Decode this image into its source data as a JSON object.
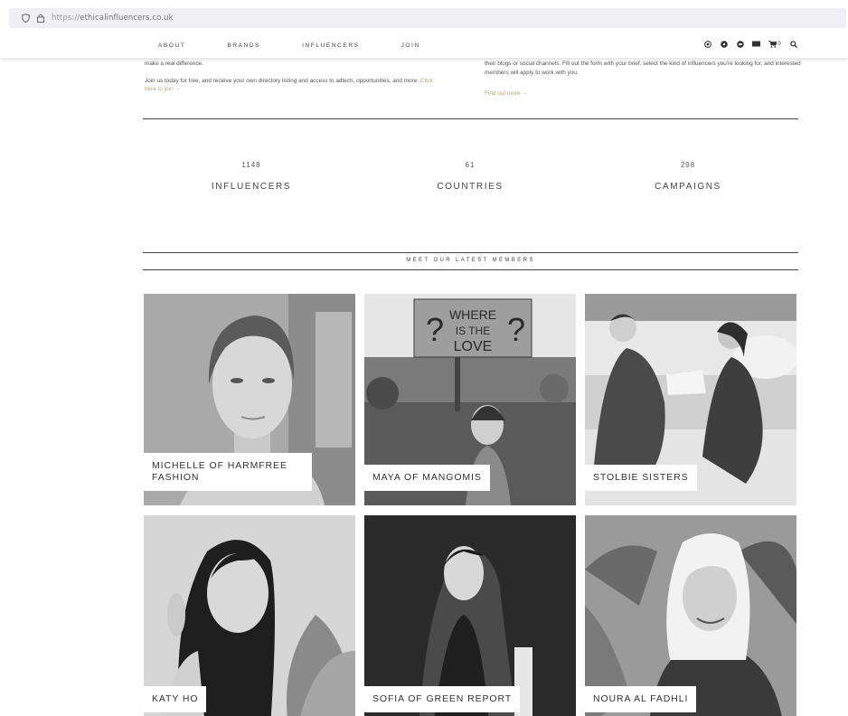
{
  "browser": {
    "url_protocol": "https://",
    "url_host": "ethicalinfluencers.co.uk"
  },
  "nav": {
    "links": [
      "ABOUT",
      "BRANDS",
      "INFLUENCERS",
      "JOIN"
    ],
    "icons": [
      "instagram-icon",
      "pinterest-icon",
      "facebook-icon",
      "email-icon",
      "cart-icon",
      "search-icon"
    ],
    "cart_count": "0"
  },
  "intro": {
    "left_line1": "make a real difference.",
    "left_line2": "Join us today for free, and receive your own directory listing and access to adtech, opportunities, and more.",
    "left_link": "Click here to join →",
    "right_line1": "their blogs or social channels. Fill out the form with your brief, select the kind of influencers you're looking for, and interested members will apply to work with you.",
    "right_link": "Find out more →"
  },
  "stats": [
    {
      "number": "1148",
      "label": "INFLUENCERS"
    },
    {
      "number": "61",
      "label": "COUNTRIES"
    },
    {
      "number": "298",
      "label": "CAMPAIGNS"
    }
  ],
  "members_heading": "MEET OUR LATEST MEMBERS",
  "members": [
    {
      "name": "MICHELLE OF HARMFREE FASHION"
    },
    {
      "name": "MAYA OF MANGOMIS"
    },
    {
      "name": "STOLBIE SISTERS"
    },
    {
      "name": "KATY HO"
    },
    {
      "name": "SOFIA OF GREEN REPORT"
    },
    {
      "name": "NOURA AL FADHLI"
    }
  ],
  "photo_sign_text": [
    "WHERE",
    "IS THE",
    "LOVE"
  ]
}
